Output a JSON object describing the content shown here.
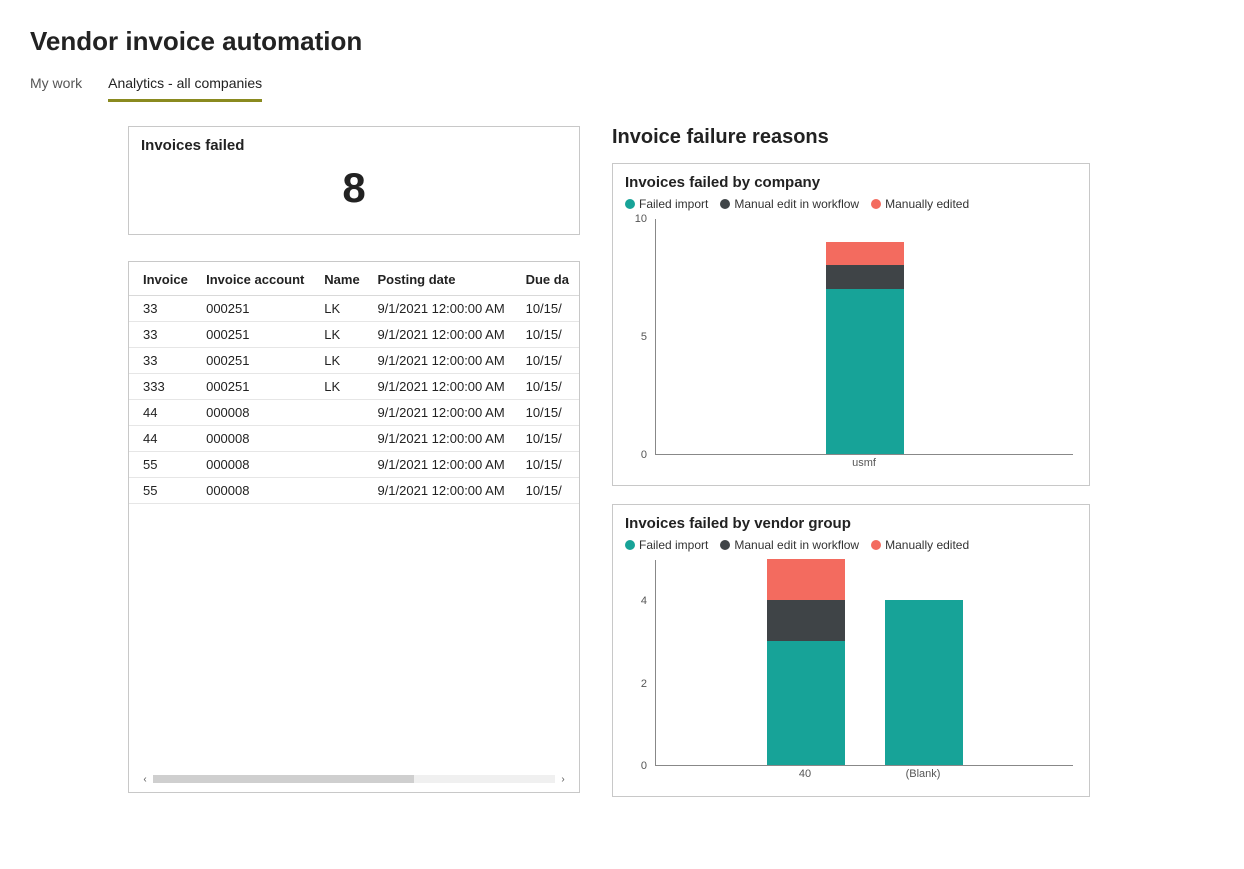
{
  "page": {
    "title": "Vendor invoice automation"
  },
  "tabs": [
    {
      "label": "My work",
      "active": false
    },
    {
      "label": "Analytics - all companies",
      "active": true
    }
  ],
  "kpi": {
    "title": "Invoices failed",
    "value": "8"
  },
  "table": {
    "columns": [
      "Invoice",
      "Invoice account",
      "Name",
      "Posting date",
      "Due da"
    ],
    "rows": [
      {
        "invoice": "33",
        "account": "000251",
        "name": "LK",
        "posting": "9/1/2021 12:00:00 AM",
        "due": "10/15/"
      },
      {
        "invoice": "33",
        "account": "000251",
        "name": "LK",
        "posting": "9/1/2021 12:00:00 AM",
        "due": "10/15/"
      },
      {
        "invoice": "33",
        "account": "000251",
        "name": "LK",
        "posting": "9/1/2021 12:00:00 AM",
        "due": "10/15/"
      },
      {
        "invoice": "333",
        "account": "000251",
        "name": "LK",
        "posting": "9/1/2021 12:00:00 AM",
        "due": "10/15/"
      },
      {
        "invoice": "44",
        "account": "000008",
        "name": "",
        "posting": "9/1/2021 12:00:00 AM",
        "due": "10/15/"
      },
      {
        "invoice": "44",
        "account": "000008",
        "name": "",
        "posting": "9/1/2021 12:00:00 AM",
        "due": "10/15/"
      },
      {
        "invoice": "55",
        "account": "000008",
        "name": "",
        "posting": "9/1/2021 12:00:00 AM",
        "due": "10/15/"
      },
      {
        "invoice": "55",
        "account": "000008",
        "name": "",
        "posting": "9/1/2021 12:00:00 AM",
        "due": "10/15/"
      }
    ]
  },
  "rightSection": {
    "title": "Invoice failure reasons"
  },
  "colors": {
    "teal": "#17a398",
    "dark": "#3f4447",
    "coral": "#f36b5f"
  },
  "legendLabels": {
    "failedImport": "Failed import",
    "manualEditWorkflow": "Manual edit in workflow",
    "manuallyEdited": "Manually edited"
  },
  "chart_data": [
    {
      "type": "bar",
      "stacked": true,
      "title": "Invoices failed by company",
      "xlabel": "",
      "ylabel": "",
      "ylim": [
        0,
        10
      ],
      "yticks": [
        0,
        5,
        10
      ],
      "categories": [
        "usmf"
      ],
      "series": [
        {
          "name": "Failed import",
          "color": "#17a398",
          "values": [
            7
          ]
        },
        {
          "name": "Manual edit in workflow",
          "color": "#3f4447",
          "values": [
            1
          ]
        },
        {
          "name": "Manually edited",
          "color": "#f36b5f",
          "values": [
            1
          ]
        }
      ]
    },
    {
      "type": "bar",
      "stacked": true,
      "title": "Invoices failed by vendor group",
      "xlabel": "",
      "ylabel": "",
      "ylim": [
        0,
        5
      ],
      "yticks": [
        0,
        2,
        4
      ],
      "categories": [
        "40",
        "(Blank)"
      ],
      "series": [
        {
          "name": "Failed import",
          "color": "#17a398",
          "values": [
            3,
            4
          ]
        },
        {
          "name": "Manual edit in workflow",
          "color": "#3f4447",
          "values": [
            1,
            0
          ]
        },
        {
          "name": "Manually edited",
          "color": "#f36b5f",
          "values": [
            1,
            0
          ]
        }
      ]
    }
  ]
}
